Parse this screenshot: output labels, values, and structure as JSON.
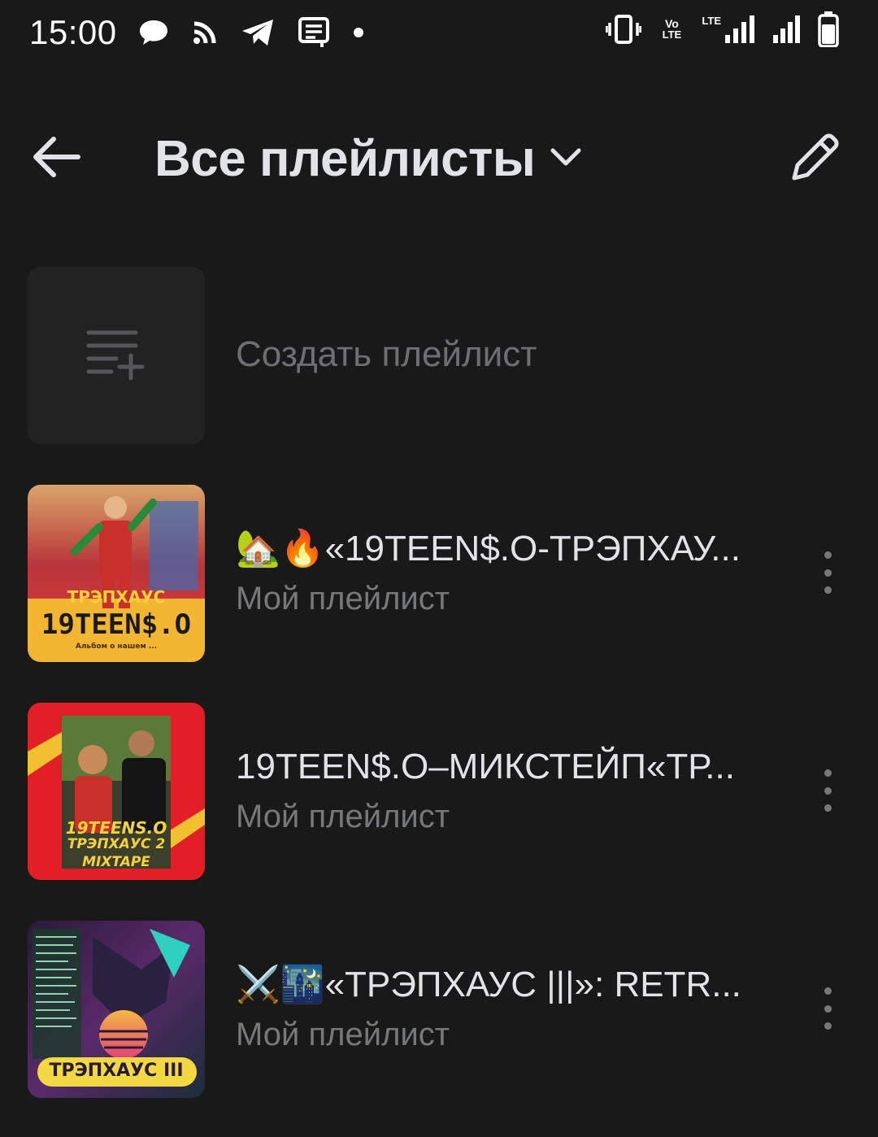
{
  "status": {
    "time": "15:00",
    "left_icons": [
      "chat-bubble-icon",
      "rss-icon",
      "telegram-icon",
      "message-icon",
      "dot-icon"
    ],
    "right_icons": [
      "vibrate-icon",
      "volte-icon",
      "lte-signal-icon",
      "signal-icon",
      "battery-icon"
    ],
    "volte_text_top": "Vo",
    "volte_text_bottom": "LTE",
    "lte_text": "LTE"
  },
  "header": {
    "title": "Все плейлисты",
    "back_icon": "arrow-left-icon",
    "dropdown_icon": "chevron-down-icon",
    "edit_icon": "pencil-icon"
  },
  "create": {
    "label": "Создать плейлист",
    "icon": "playlist-add-icon"
  },
  "playlists": [
    {
      "title": "🏡🔥«19TEEN$.O-ТРЭПХАУ...",
      "subtitle": "Мой плейлист",
      "cover_caption_top": "ТРЭПХАУС",
      "cover_caption_main": "19TEEN$.O",
      "cover_caption_small": "Альбом о нашем ...",
      "accent": "#e43a3a"
    },
    {
      "title": "19TEEN$.O–МИКСТЕЙП«ТР...",
      "subtitle": "Мой плейлист",
      "cover_caption_main": "19TEENS.O",
      "cover_caption_mid": "ТРЭПХАУС 2",
      "cover_caption_bottom": "MIXTAPE",
      "accent": "#e21f26"
    },
    {
      "title": "⚔️🌃«ТРЭПХАУС |||»: RETR...",
      "subtitle": "Мой плейлист",
      "cover_caption_main": "ТРЭПХАУС III",
      "accent": "#f2d843"
    }
  ]
}
